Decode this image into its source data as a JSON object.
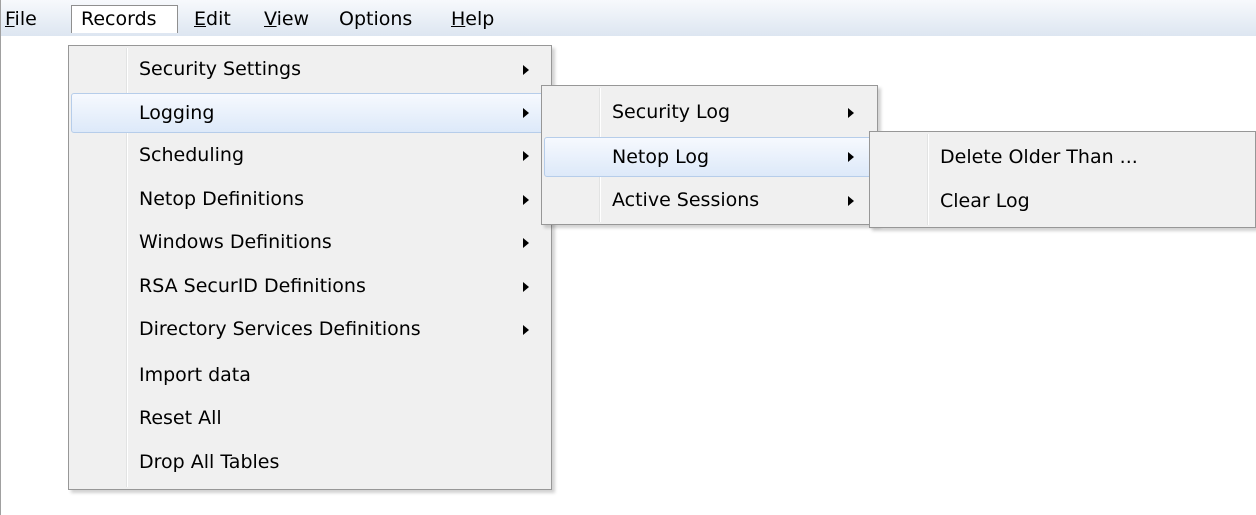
{
  "menubar": {
    "file": {
      "label_accel": "F",
      "label_rest": "ile"
    },
    "records": {
      "label": "Records"
    },
    "edit": {
      "label_accel": "E",
      "label_rest": "dit"
    },
    "view": {
      "label_accel": "V",
      "label_rest": "iew"
    },
    "options": {
      "label": "Options"
    },
    "help": {
      "label_accel": "H",
      "label_rest": "elp"
    }
  },
  "records_menu": {
    "items": [
      {
        "label": "Security Settings",
        "submenu": true
      },
      {
        "label": "Logging",
        "submenu": true,
        "highlighted": true
      },
      {
        "label": "Scheduling",
        "submenu": true
      },
      {
        "label": "Netop Definitions",
        "submenu": true
      },
      {
        "label": "Windows Definitions",
        "submenu": true
      },
      {
        "label": "RSA SecurID Definitions",
        "submenu": true
      },
      {
        "label": "Directory Services Definitions",
        "submenu": true
      },
      {
        "label": "Import data",
        "submenu": false
      },
      {
        "label": "Reset All",
        "submenu": false
      },
      {
        "label": "Drop All Tables",
        "submenu": false
      }
    ]
  },
  "logging_menu": {
    "items": [
      {
        "label": "Security Log",
        "submenu": true
      },
      {
        "label": "Netop Log",
        "submenu": true,
        "highlighted": true
      },
      {
        "label": "Active Sessions",
        "submenu": true
      }
    ]
  },
  "netop_log_menu": {
    "items": [
      {
        "label": "Delete Older Than ..."
      },
      {
        "label": "Clear Log"
      }
    ]
  },
  "colors": {
    "highlight_border": "#b6cdea",
    "menu_background": "#f0f0f0",
    "menubar_gradient_top": "#f7f9fc",
    "menubar_gradient_bottom": "#dde6f1"
  }
}
